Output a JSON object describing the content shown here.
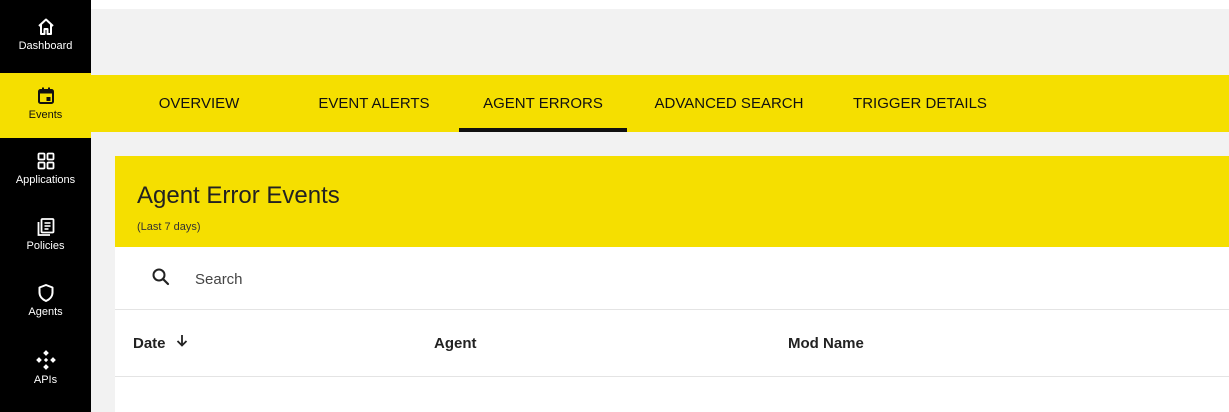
{
  "sidebar": {
    "items": [
      {
        "label": "Dashboard",
        "icon": "home-icon",
        "active": false
      },
      {
        "label": "Events",
        "icon": "calendar-icon",
        "active": true
      },
      {
        "label": "Applications",
        "icon": "grid-icon",
        "active": false
      },
      {
        "label": "Policies",
        "icon": "document-icon",
        "active": false
      },
      {
        "label": "Agents",
        "icon": "shield-icon",
        "active": false
      },
      {
        "label": "APIs",
        "icon": "api-icon",
        "active": false
      }
    ]
  },
  "tabs": [
    {
      "label": "OVERVIEW",
      "active": false
    },
    {
      "label": "EVENT ALERTS",
      "active": false
    },
    {
      "label": "AGENT ERRORS",
      "active": true
    },
    {
      "label": "ADVANCED SEARCH",
      "active": false
    },
    {
      "label": "TRIGGER DETAILS",
      "active": false
    }
  ],
  "card": {
    "title": "Agent Error Events",
    "subtitle": "(Last 7 days)"
  },
  "search": {
    "placeholder": "Search",
    "value": ""
  },
  "table": {
    "columns": [
      {
        "label": "Date",
        "sort": "descending"
      },
      {
        "label": "Agent"
      },
      {
        "label": "Mod Name"
      }
    ]
  },
  "colors": {
    "accent": "#f5df00",
    "sidebar_bg": "#000000",
    "page_bg": "#f2f2f2"
  }
}
